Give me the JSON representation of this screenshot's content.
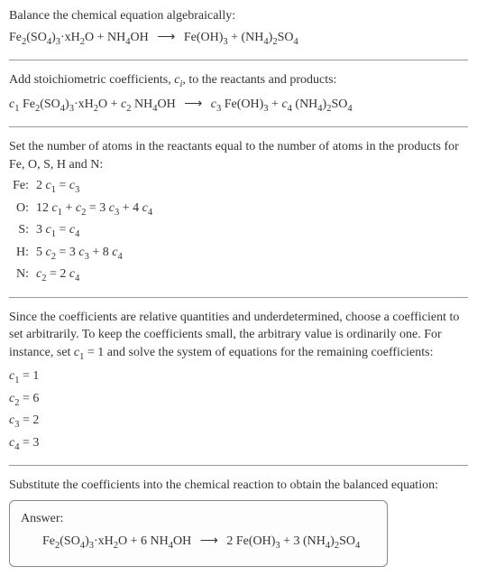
{
  "intro": {
    "line1": "Balance the chemical equation algebraically:",
    "eq_lhs1": "Fe",
    "eq_lhs1_sub1": "2",
    "eq_lhs2": "(SO",
    "eq_lhs2_sub1": "4",
    "eq_lhs3": ")",
    "eq_lhs3_sub1": "3",
    "eq_lhs4": "·xH",
    "eq_lhs4_sub1": "2",
    "eq_lhs5": "O + NH",
    "eq_lhs5_sub1": "4",
    "eq_lhs6": "OH",
    "arrow": "⟶",
    "eq_rhs1": "Fe(OH)",
    "eq_rhs1_sub1": "3",
    "eq_rhs2": " + (NH",
    "eq_rhs2_sub1": "4",
    "eq_rhs3": ")",
    "eq_rhs3_sub1": "2",
    "eq_rhs4": "SO",
    "eq_rhs4_sub1": "4"
  },
  "step1": {
    "text1": "Add stoichiometric coefficients, ",
    "ci": "c",
    "ci_sub": "i",
    "text2": ", to the reactants and products:",
    "c1": "c",
    "c1_sub": "1",
    "sp1": " Fe",
    "sp1_sub1": "2",
    "sp2": "(SO",
    "sp2_sub1": "4",
    "sp3": ")",
    "sp3_sub1": "3",
    "sp4": "·xH",
    "sp4_sub1": "2",
    "sp5": "O + ",
    "c2": "c",
    "c2_sub": "2",
    "sp6": " NH",
    "sp6_sub1": "4",
    "sp7": "OH",
    "arrow": "⟶",
    "c3": "c",
    "c3_sub": "3",
    "sp8": " Fe(OH)",
    "sp8_sub1": "3",
    "sp9": " + ",
    "c4": "c",
    "c4_sub": "4",
    "sp10": " (NH",
    "sp10_sub1": "4",
    "sp11": ")",
    "sp11_sub1": "2",
    "sp12": "SO",
    "sp12_sub1": "4"
  },
  "step2": {
    "text": "Set the number of atoms in the reactants equal to the number of atoms in the products for Fe, O, S, H and N:",
    "rows": [
      {
        "label": "Fe:",
        "lhs": "2",
        "c1": "c",
        "c1s": "1",
        "mid": " = ",
        "c2": "c",
        "c2s": "3"
      },
      {
        "label": "O:",
        "lhs": "12",
        "c1": "c",
        "c1s": "1",
        "mid1": " + ",
        "c2": "c",
        "c2s": "2",
        "mid2": " = 3",
        "c3": "c",
        "c3s": "3",
        "mid3": " + 4",
        "c4": "c",
        "c4s": "4"
      },
      {
        "label": "S:",
        "lhs": "3",
        "c1": "c",
        "c1s": "1",
        "mid": " = ",
        "c2": "c",
        "c2s": "4"
      },
      {
        "label": "H:",
        "lhs": "5",
        "c1": "c",
        "c1s": "2",
        "mid1": " = 3",
        "c2": "c",
        "c2s": "3",
        "mid2": " + 8",
        "c3": "c",
        "c3s": "4"
      },
      {
        "label": "N:",
        "c1": "c",
        "c1s": "2",
        "mid": " = 2",
        "c2": "c",
        "c2s": "4"
      }
    ]
  },
  "step3": {
    "text1": "Since the coefficients are relative quantities and underdetermined, choose a coefficient to set arbitrarily. To keep the coefficients small, the arbitrary value is ordinarily one. For instance, set ",
    "cvar": "c",
    "cvar_sub": "1",
    "text2": " = 1 and solve the system of equations for the remaining coefficients:",
    "coeffs": [
      {
        "c": "c",
        "cs": "1",
        "eq": " = 1"
      },
      {
        "c": "c",
        "cs": "2",
        "eq": " = 6"
      },
      {
        "c": "c",
        "cs": "3",
        "eq": " = 2"
      },
      {
        "c": "c",
        "cs": "4",
        "eq": " = 3"
      }
    ]
  },
  "step4": {
    "text": "Substitute the coefficients into the chemical reaction to obtain the balanced equation:"
  },
  "answer": {
    "label": "Answer:",
    "lhs1": "Fe",
    "lhs1_sub": "2",
    "lhs2": "(SO",
    "lhs2_sub": "4",
    "lhs3": ")",
    "lhs3_sub": "3",
    "lhs4": "·xH",
    "lhs4_sub": "2",
    "lhs5": "O + 6 NH",
    "lhs5_sub": "4",
    "lhs6": "OH",
    "arrow": "⟶",
    "rhs1": "2 Fe(OH)",
    "rhs1_sub": "3",
    "rhs2": " + 3 (NH",
    "rhs2_sub": "4",
    "rhs3": ")",
    "rhs3_sub": "2",
    "rhs4": "SO",
    "rhs4_sub": "4"
  }
}
